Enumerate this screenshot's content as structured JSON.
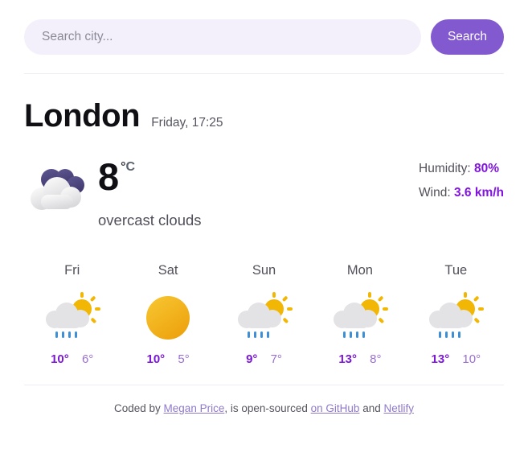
{
  "search": {
    "placeholder": "Search city...",
    "value": "",
    "button_label": "Search"
  },
  "current": {
    "city": "London",
    "datetime": "Friday, 17:25",
    "temperature": "8",
    "degree_symbol": "°",
    "unit": "C",
    "description": "overcast clouds",
    "icon": "overcast-clouds-icon",
    "humidity_label": "Humidity:",
    "humidity_value": "80%",
    "wind_label": "Wind:",
    "wind_value": "3.6 km/h"
  },
  "forecast": [
    {
      "day": "Fri",
      "icon": "rain-sun-icon",
      "max": "10°",
      "min": "6°"
    },
    {
      "day": "Sat",
      "icon": "sun-icon",
      "max": "10°",
      "min": "5°"
    },
    {
      "day": "Sun",
      "icon": "rain-sun-icon",
      "max": "9°",
      "min": "7°"
    },
    {
      "day": "Mon",
      "icon": "rain-sun-icon",
      "max": "13°",
      "min": "8°"
    },
    {
      "day": "Tue",
      "icon": "rain-sun-icon",
      "max": "13°",
      "min": "10°"
    }
  ],
  "footer": {
    "prefix": "Coded by ",
    "author": "Megan Price",
    "middle": ", is open-sourced ",
    "github": "on GitHub",
    "conjunction": " and ",
    "netlify": "Netlify"
  },
  "colors": {
    "accent": "#8259cf",
    "accent_strong": "#8214e0",
    "input_bg": "#f4f0fb",
    "divider": "#efecf7",
    "sun": "#f2b705",
    "rain": "#3f8fd6",
    "cloud_dark": "#514b86"
  }
}
